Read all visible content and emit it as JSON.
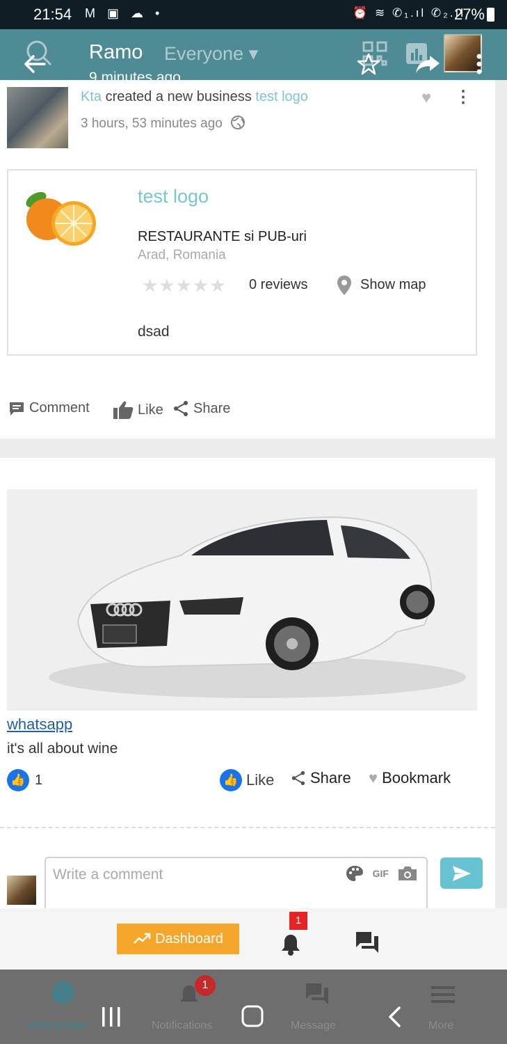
{
  "status_bar": {
    "time": "21:54",
    "left_icons": "M ▣ ☁ •",
    "signal": "⏰ ≋ ✆₁.ıl ✆₂.ıl",
    "battery": "27%"
  },
  "header": {
    "title": "Ramo",
    "audience": "Everyone ▾",
    "subtitle": "9 minutes ago"
  },
  "post1": {
    "author": "Kta",
    "action_text": " created a new business ",
    "target": "test logo",
    "time": "3 hours, 53 minutes ago",
    "business": {
      "name": "test logo",
      "category": "RESTAURANTE si PUB-uri",
      "location": "Arad, Romania",
      "stars": "★★★★★",
      "reviews": "0 reviews",
      "show_map": "Show map",
      "description": "dsad"
    },
    "actions": {
      "comment": "Comment",
      "like": "Like",
      "share": "Share"
    }
  },
  "post2": {
    "image_alt": "white Audi car",
    "link": "whatsapp",
    "caption": "it's all about wine",
    "like_count": "1",
    "actions": {
      "like": "Like",
      "share": "Share",
      "bookmark": "Bookmark"
    },
    "comment_placeholder": "Write a comment",
    "gif": "GIF"
  },
  "tab_bar": {
    "dashboard": "Dashboard",
    "notification_badge": "1"
  },
  "bottom_nav": {
    "items": [
      {
        "label": "What's New",
        "icon": "globe-icon"
      },
      {
        "label": "Notifications",
        "icon": "bell-icon",
        "badge": "1"
      },
      {
        "label": "Message",
        "icon": "chat-icon"
      },
      {
        "label": "More",
        "icon": "menu-icon"
      }
    ]
  },
  "colors": {
    "header": "#4f8b95",
    "accent": "#78c6d0",
    "dashboard": "#f4a52a",
    "badge": "#e52525",
    "like_blue": "#1a73e8"
  }
}
